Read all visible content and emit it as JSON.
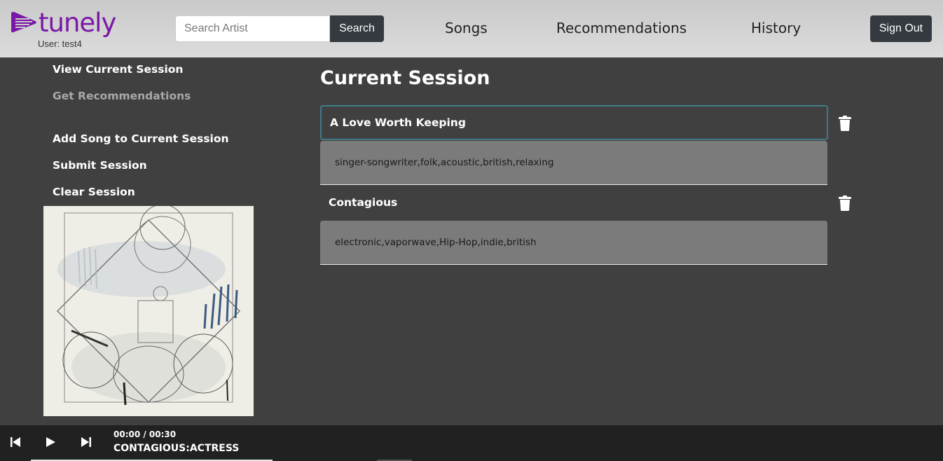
{
  "header": {
    "logo_text": "tunely",
    "user_label": "User: test4",
    "search_placeholder": "Search Artist",
    "search_button": "Search",
    "nav": [
      "Songs",
      "Recommendations",
      "History"
    ],
    "sign_out": "Sign Out"
  },
  "sidebar": {
    "items": [
      {
        "label": "View Current Session"
      },
      {
        "label": "Get Recommendations"
      },
      {
        "label": "Add Song to Current Session"
      },
      {
        "label": "Submit Session"
      },
      {
        "label": "Clear Session"
      }
    ]
  },
  "main": {
    "title": "Current Session",
    "songs": [
      {
        "title": "A Love Worth Keeping",
        "tags": "singer-songwriter,folk,acoustic,british,relaxing"
      },
      {
        "title": "Contagious",
        "tags": "electronic,vaporwave,Hip-Hop,indie,british"
      }
    ]
  },
  "player": {
    "time": "00:00 / 00:30",
    "track": "CONTAGIOUS:ACTRESS"
  },
  "colors": {
    "brand": "#7b17a7",
    "accent_border": "#3f7a87",
    "background": "#404040"
  }
}
